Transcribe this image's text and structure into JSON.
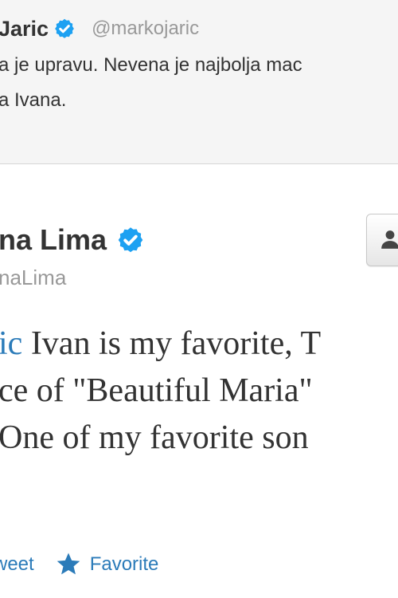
{
  "parent_tweet": {
    "author_name": "Jaric",
    "handle": "@markojaric",
    "text_lines": [
      "a je upravu. Nevena je najbolja mac",
      "a Ivana."
    ]
  },
  "tweet": {
    "author_name": "na Lima",
    "handle": "naLima",
    "mention": "ic",
    "text_line1_rest": " Ivan is my favorite, T",
    "text_line2": "ce of \"Beautiful Maria\"",
    "text_line3": "One of my favorite son"
  },
  "actions": {
    "retweet_label": "weet",
    "favorite_label": "Favorite"
  },
  "colors": {
    "link": "#2b7bb9",
    "verified": "#1da1f2",
    "parent_background": "#f5f5f5"
  },
  "icons": {
    "verified": "verified-badge-icon",
    "follow": "user-icon",
    "favorite": "star-icon"
  }
}
